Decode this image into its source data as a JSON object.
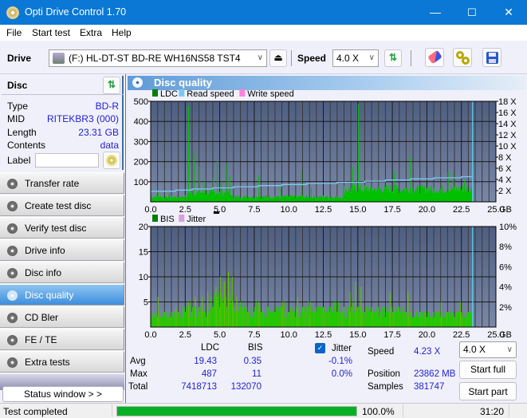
{
  "window": {
    "title": "Opti Drive Control 1.70",
    "minimize": "—",
    "maximize": "☐",
    "close": "✕"
  },
  "menu": [
    "File",
    "Start test",
    "Extra",
    "Help"
  ],
  "toolbar": {
    "drive_label": "Drive",
    "drive_value": "(F:)  HL-DT-ST BD-RE  WH16NS58 TST4",
    "speed_label": "Speed",
    "speed_value": "4.0 X",
    "icons": [
      "eject-icon",
      "refresh-icon",
      "erase-icon",
      "settings-icon",
      "save-icon"
    ]
  },
  "disc": {
    "title": "Disc",
    "fields": [
      {
        "key": "Type",
        "value": "BD-R"
      },
      {
        "key": "MID",
        "value": "RITEKBR3 (000)"
      },
      {
        "key": "Length",
        "value": "23.31 GB"
      },
      {
        "key": "Contents",
        "value": "data"
      }
    ],
    "label_key": "Label",
    "label_value": ""
  },
  "nav": [
    {
      "label": "Transfer rate",
      "active": false
    },
    {
      "label": "Create test disc",
      "active": false
    },
    {
      "label": "Verify test disc",
      "active": false
    },
    {
      "label": "Drive info",
      "active": false
    },
    {
      "label": "Disc info",
      "active": false
    },
    {
      "label": "Disc quality",
      "active": true
    },
    {
      "label": "CD Bler",
      "active": false
    },
    {
      "label": "FE / TE",
      "active": false
    },
    {
      "label": "Extra tests",
      "active": false
    }
  ],
  "status_window_label": "Status window > >",
  "panel_title": "Disc quality",
  "colors": {
    "ldc": "#00c000",
    "read_speed": "#7ac8f0",
    "write_speed": "#ff80e0",
    "bis": "#00c000",
    "jitter": "#d8a0d8",
    "plot_top": "#4e5e80",
    "plot_bottom": "#7a88a8"
  },
  "chart_data": [
    {
      "type": "bar",
      "title": "LDC / Read speed",
      "legend": [
        "LDC",
        "Read speed",
        "Write speed"
      ],
      "legend_position": "top-left",
      "xlabel": "GB",
      "xlim": [
        0,
        25
      ],
      "x_ticks": [
        "0.0",
        "2.5",
        "5.0",
        "7.5",
        "10.0",
        "12.5",
        "15.0",
        "17.5",
        "20.0",
        "22.5",
        "25.0"
      ],
      "ylim": [
        0,
        500
      ],
      "y_ticks": [
        "100",
        "200",
        "300",
        "400",
        "500"
      ],
      "y2lim": [
        0,
        18
      ],
      "y2_ticks": [
        "2 X",
        "4 X",
        "6 X",
        "8 X",
        "10 X",
        "12 X",
        "14 X",
        "16 X",
        "18 X"
      ],
      "grid": true,
      "ldc_segments": [
        {
          "x": [
            0.0,
            2.6
          ],
          "base": 30
        },
        {
          "x": [
            2.6,
            5.8
          ],
          "base": 55
        },
        {
          "x": [
            5.8,
            13.9
          ],
          "base": 30
        },
        {
          "x": [
            13.9,
            23.31
          ],
          "base": 75
        }
      ],
      "ldc_spikes": [
        {
          "x": 0.5,
          "y": 50
        },
        {
          "x": 1.3,
          "y": 45
        },
        {
          "x": 2.7,
          "y": 480
        },
        {
          "x": 3.1,
          "y": 245
        },
        {
          "x": 3.5,
          "y": 175
        },
        {
          "x": 3.9,
          "y": 100
        },
        {
          "x": 4.5,
          "y": 120
        },
        {
          "x": 4.8,
          "y": 210
        },
        {
          "x": 5.1,
          "y": 100
        },
        {
          "x": 5.5,
          "y": 190
        },
        {
          "x": 5.7,
          "y": 130
        },
        {
          "x": 7.8,
          "y": 130
        },
        {
          "x": 9.4,
          "y": 80
        },
        {
          "x": 10.9,
          "y": 160
        },
        {
          "x": 11.6,
          "y": 70
        },
        {
          "x": 14.6,
          "y": 175
        },
        {
          "x": 15.0,
          "y": 487
        },
        {
          "x": 17.6,
          "y": 150
        },
        {
          "x": 18.8,
          "y": 225
        },
        {
          "x": 21.5,
          "y": 150
        },
        {
          "x": 21.9,
          "y": 145
        },
        {
          "x": 22.7,
          "y": 110
        }
      ],
      "read_speed": [
        {
          "x": 0.0,
          "y": 1.9
        },
        {
          "x": 1.8,
          "y": 2.1
        },
        {
          "x": 3.0,
          "y": 2.3
        },
        {
          "x": 4.5,
          "y": 2.5
        },
        {
          "x": 6.0,
          "y": 2.7
        },
        {
          "x": 7.8,
          "y": 2.9
        },
        {
          "x": 9.5,
          "y": 3.1
        },
        {
          "x": 11.3,
          "y": 3.3
        },
        {
          "x": 13.5,
          "y": 3.5
        },
        {
          "x": 15.5,
          "y": 3.7
        },
        {
          "x": 17.0,
          "y": 3.9
        },
        {
          "x": 18.8,
          "y": 4.1
        },
        {
          "x": 20.5,
          "y": 4.3
        },
        {
          "x": 22.5,
          "y": 4.5
        },
        {
          "x": 23.31,
          "y": 4.5
        }
      ],
      "end_marker_gb": 23.31
    },
    {
      "type": "bar",
      "title": "BIS / Jitter",
      "legend": [
        "BIS",
        "Jitter"
      ],
      "legend_position": "top-left",
      "xlabel": "GB",
      "xlim": [
        0,
        25
      ],
      "x_ticks": [
        "0.0",
        "2.5",
        "5.0",
        "7.5",
        "10.0",
        "12.5",
        "15.0",
        "17.5",
        "20.0",
        "22.5",
        "25.0"
      ],
      "ylim": [
        0,
        20
      ],
      "y_ticks": [
        "5",
        "10",
        "15",
        "20"
      ],
      "y2lim": [
        0,
        10
      ],
      "y2_ticks": [
        "2%",
        "4%",
        "6%",
        "8%",
        "10%"
      ],
      "grid": true,
      "bis_segments": [
        {
          "x": [
            0.0,
            2.3
          ],
          "base": 3
        },
        {
          "x": [
            2.3,
            4.3
          ],
          "base": 4
        },
        {
          "x": [
            4.3,
            6.0
          ],
          "base": 6
        },
        {
          "x": [
            6.0,
            13.5
          ],
          "base": 4
        },
        {
          "x": [
            13.5,
            18.5
          ],
          "base": 4
        },
        {
          "x": [
            18.5,
            23.31
          ],
          "base": 3
        }
      ],
      "bis_spikes": [
        {
          "x": 0.5,
          "y": 6
        },
        {
          "x": 1.8,
          "y": 4
        },
        {
          "x": 2.7,
          "y": 5
        },
        {
          "x": 3.2,
          "y": 6
        },
        {
          "x": 3.7,
          "y": 6
        },
        {
          "x": 4.1,
          "y": 7
        },
        {
          "x": 4.7,
          "y": 8
        },
        {
          "x": 5.0,
          "y": 10
        },
        {
          "x": 5.3,
          "y": 9
        },
        {
          "x": 5.6,
          "y": 11
        },
        {
          "x": 5.9,
          "y": 10
        },
        {
          "x": 6.2,
          "y": 6
        },
        {
          "x": 7.8,
          "y": 5
        },
        {
          "x": 9.5,
          "y": 5
        },
        {
          "x": 10.6,
          "y": 6
        },
        {
          "x": 11.5,
          "y": 5
        },
        {
          "x": 14.4,
          "y": 7
        },
        {
          "x": 14.8,
          "y": 9
        },
        {
          "x": 15.2,
          "y": 8
        },
        {
          "x": 17.3,
          "y": 7
        },
        {
          "x": 18.6,
          "y": 7
        },
        {
          "x": 21.0,
          "y": 5
        },
        {
          "x": 22.4,
          "y": 5
        }
      ],
      "end_marker_gb": 23.31
    }
  ],
  "stats": {
    "col_ldc": "LDC",
    "col_bis": "BIS",
    "jitter_label": "Jitter",
    "jitter_checked": true,
    "rows": [
      {
        "label": "Avg",
        "ldc": "19.43",
        "bis": "0.35",
        "jitter": "-0.1%"
      },
      {
        "label": "Max",
        "ldc": "487",
        "bis": "11",
        "jitter": "0.0%"
      },
      {
        "label": "Total",
        "ldc": "7418713",
        "bis": "132070",
        "jitter": ""
      }
    ],
    "speed_label": "Speed",
    "speed_value": "4.23 X",
    "position_label": "Position",
    "position_value": "23862 MB",
    "samples_label": "Samples",
    "samples_value": "381747",
    "speed_select": "4.0 X",
    "start_full": "Start full",
    "start_part": "Start part"
  },
  "statusbar": {
    "text": "Test completed",
    "progress": 100.0,
    "progress_text": "100.0%",
    "time": "31:20"
  }
}
